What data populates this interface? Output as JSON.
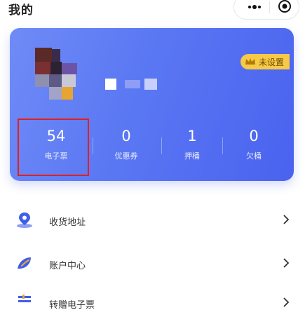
{
  "header": {
    "title": "我的"
  },
  "profile": {
    "badge_label": "未设置"
  },
  "stats": [
    {
      "value": "54",
      "label": "电子票"
    },
    {
      "value": "0",
      "label": "优惠券"
    },
    {
      "value": "1",
      "label": "押桶"
    },
    {
      "value": "0",
      "label": "欠桶"
    }
  ],
  "menu": [
    {
      "label": "收货地址",
      "icon": "location-pin-icon"
    },
    {
      "label": "账户中心",
      "icon": "wallet-icon"
    },
    {
      "label": "转赠电子票",
      "icon": "ticket-transfer-icon"
    }
  ],
  "colors": {
    "card_start": "#6f8bf7",
    "card_end": "#4a62ef",
    "badge": "#f7c948",
    "highlight": "#e02020",
    "icon_blue": "#3f5fe8"
  }
}
